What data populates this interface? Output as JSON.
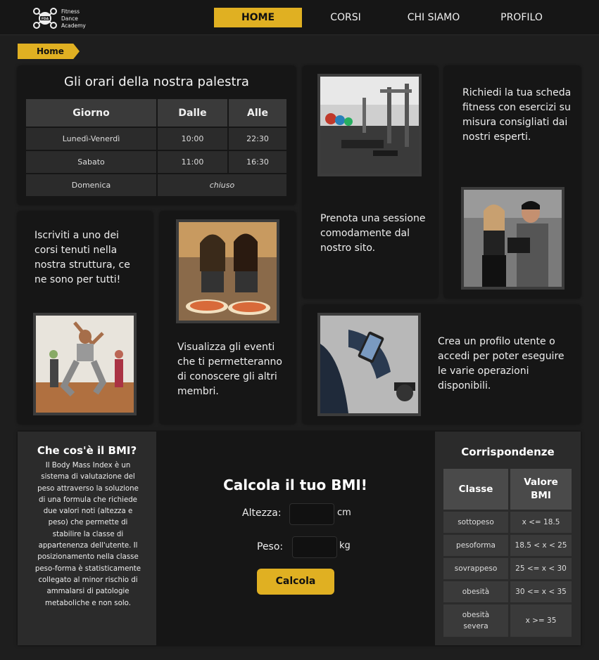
{
  "nav": {
    "logo_lines": [
      "Fitness",
      "Dance",
      "Academy"
    ],
    "logo_badge": "FDA",
    "items": [
      {
        "label": "HOME",
        "active": true
      },
      {
        "label": "CORSI",
        "active": false
      },
      {
        "label": "CHI SIAMO",
        "active": false
      },
      {
        "label": "PROFILO",
        "active": false
      }
    ]
  },
  "breadcrumb": {
    "label": "Home"
  },
  "hours": {
    "title": "Gli orari della nostra palestra",
    "headers": [
      "Giorno",
      "Dalle",
      "Alle"
    ],
    "rows": [
      {
        "day": "Lunedì-Venerdì",
        "from": "10:00",
        "to": "22:30"
      },
      {
        "day": "Sabato",
        "from": "11:00",
        "to": "16:30"
      },
      {
        "day": "Domenica",
        "closed": "chiuso"
      }
    ]
  },
  "cards": {
    "booking": "Prenota una sessione comodamente dal nostro sito.",
    "plan": "Richiedi la tua scheda fitness con esercizi su misura consigliati dai nostri esperti.",
    "courses": "Iscriviti a uno dei corsi tenuti nella nostra struttura, ce ne sono per tutti!",
    "events": "Visualizza gli eventi che ti permetteranno di conoscere gli altri membri.",
    "profile": "Crea un profilo utente o accedi per poter eseguire le varie operazioni disponibili."
  },
  "bmi_info": {
    "title": "Che cos'è il BMI?",
    "text": "Il Body Mass Index è un sistema di valutazione del peso attraverso la soluzione di una formula che richiede due valori noti (altezza e peso) che permette di stabilire la classe di appartenenza dell'utente. Il posizionamento nella classe peso-forma è statisticamente collegato al minor rischio di ammalarsi di patologie metaboliche e non solo."
  },
  "calculator": {
    "title": "Calcola il tuo BMI!",
    "height_label": "Altezza:",
    "height_unit": "cm",
    "height_value": "",
    "weight_label": "Peso:",
    "weight_unit": "kg",
    "weight_value": "",
    "button": "Calcola"
  },
  "corrispondenze": {
    "title": "Corrispondenze",
    "headers": [
      "Classe",
      "Valore BMI"
    ],
    "rows": [
      {
        "classe": "sottopeso",
        "valore": "x <= 18.5"
      },
      {
        "classe": "pesoforma",
        "valore": "18.5 < x < 25"
      },
      {
        "classe": "sovrappeso",
        "valore": "25 <= x < 30"
      },
      {
        "classe": "obesità",
        "valore": "30 <= x < 35"
      },
      {
        "classe": "obesità severa",
        "valore": "x >= 35"
      }
    ]
  },
  "colors": {
    "accent": "#e0b022",
    "background": "#1e1e1e",
    "card": "#161616"
  }
}
